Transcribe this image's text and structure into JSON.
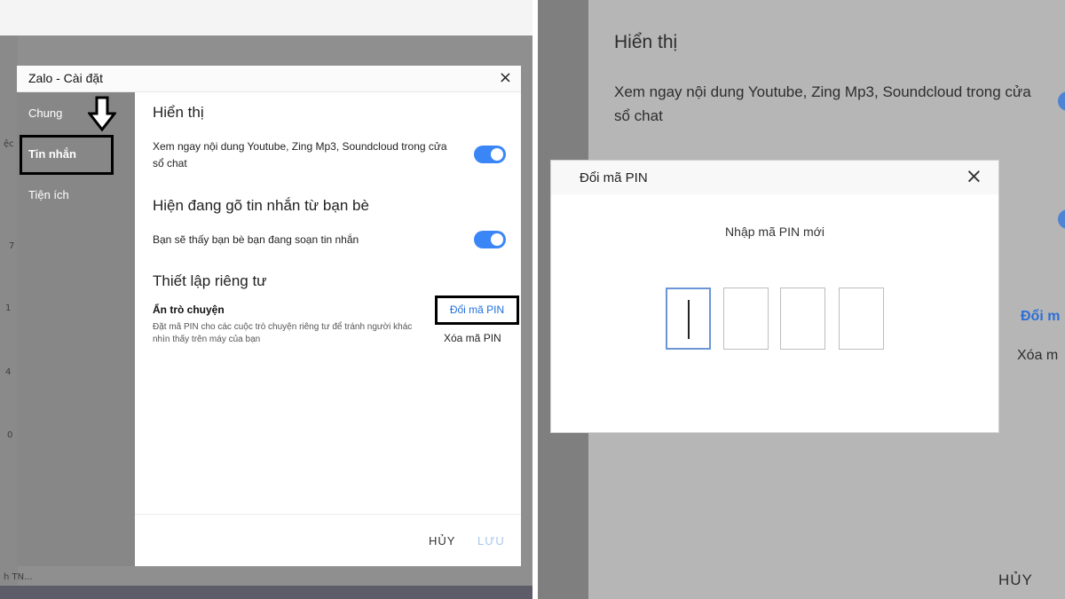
{
  "left": {
    "bg_fragments": [
      "ệc",
      "7",
      "1",
      "0",
      "4",
      "h TN..."
    ],
    "window": {
      "title": "Zalo - Cài đặt",
      "close_glyph": "×",
      "sidebar": [
        {
          "label": "Chung"
        },
        {
          "label": "Tin nhắn"
        },
        {
          "label": "Tiện ích"
        }
      ],
      "section1": {
        "heading": "Hiển thị",
        "option_text": "Xem ngay nội dung Youtube, Zing Mp3, Soundcloud trong cửa sổ chat"
      },
      "section2": {
        "heading": "Hiện đang gõ tin nhắn từ bạn bè",
        "option_text": "Bạn sẽ thấy bạn bè bạn đang soạn tin nhắn"
      },
      "section3": {
        "heading": "Thiết lập riêng tư",
        "option_title": "Ẩn trò chuyện",
        "option_desc": "Đặt mã PIN cho các cuộc trò chuyện riêng tư để tránh người khác nhìn thấy trên máy của bạn",
        "change_pin": "Đổi mã PIN",
        "delete_pin": "Xóa mã PIN"
      },
      "footer": {
        "cancel": "HỦY",
        "save": "LƯU"
      }
    }
  },
  "right": {
    "bg": {
      "heading": "Hiển thị",
      "text": "Xem ngay nội dung Youtube, Zing Mp3, Soundcloud trong cửa sổ chat",
      "change_pin": "Đổi m",
      "delete_pin": "Xóa m",
      "cancel": "HỦY"
    },
    "dialog": {
      "title": "Đổi mã PIN",
      "close_glyph": "×",
      "prompt": "Nhập mã PIN mới",
      "pin_length": 4
    }
  },
  "colors": {
    "toggle_on": "#3b86f7",
    "link_blue": "#1f6fde",
    "focus_border": "#6b95d6"
  }
}
